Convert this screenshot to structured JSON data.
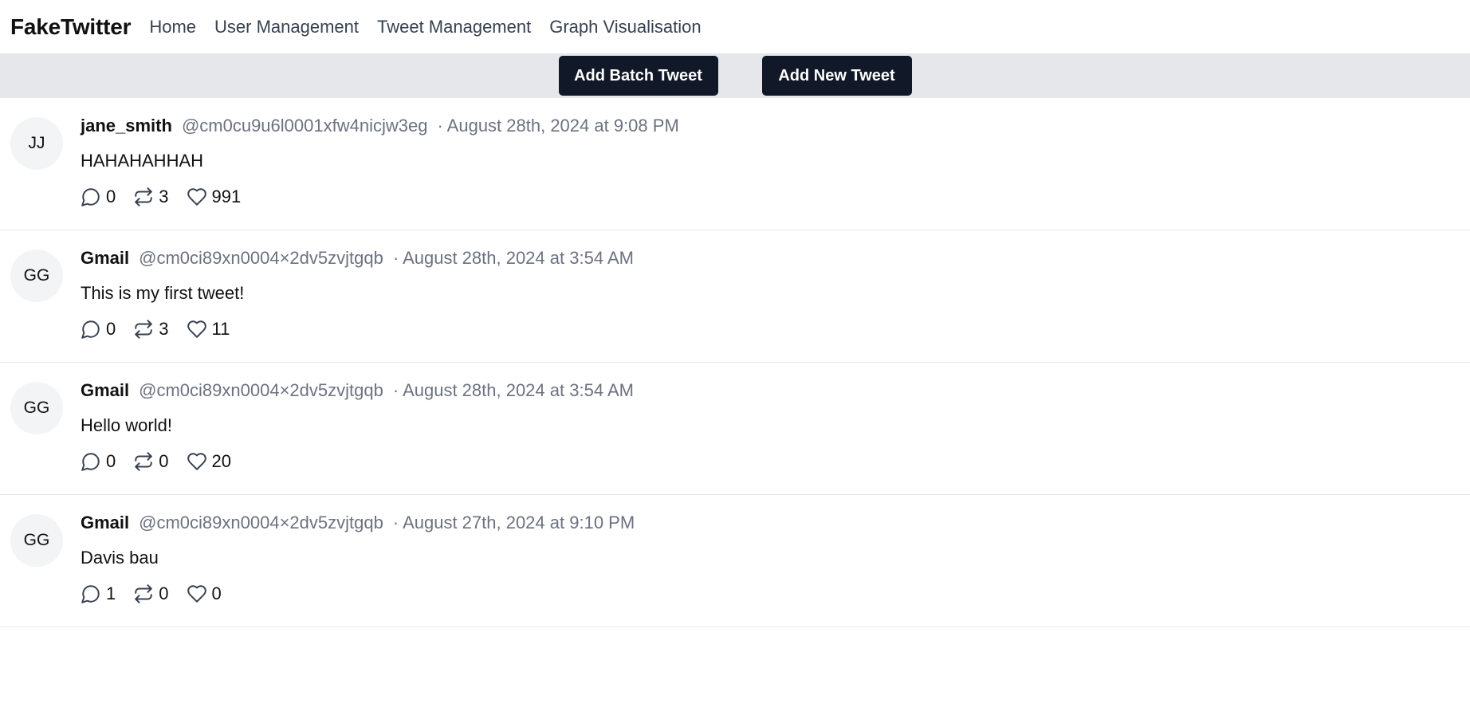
{
  "nav": {
    "brand": "FakeTwitter",
    "links": [
      "Home",
      "User Management",
      "Tweet Management",
      "Graph Visualisation"
    ]
  },
  "actions": {
    "add_batch": "Add Batch Tweet",
    "add_new": "Add New Tweet"
  },
  "colors": {
    "button_bg": "#111827",
    "action_bar_bg": "#e5e7eb",
    "muted_text": "#6b7280",
    "avatar_bg": "#f3f4f6"
  },
  "icons": {
    "reply": "speech-bubble-icon",
    "retweet": "retweet-arrows-icon",
    "like": "heart-icon"
  },
  "tweets": [
    {
      "initials": "JJ",
      "username": "jane_smith",
      "handle": "@cm0cu9u6l0001xfw4nicjw3eg",
      "timestamp": "· August 28th, 2024 at 9:08 PM",
      "content": "HAHAHAHHAH",
      "replies": "0",
      "retweets": "3",
      "likes": "991"
    },
    {
      "initials": "GG",
      "username": "Gmail",
      "handle": "@cm0ci89xn0004×2dv5zvjtgqb",
      "timestamp": "· August 28th, 2024 at 3:54 AM",
      "content": "This is my first tweet!",
      "replies": "0",
      "retweets": "3",
      "likes": "11"
    },
    {
      "initials": "GG",
      "username": "Gmail",
      "handle": "@cm0ci89xn0004×2dv5zvjtgqb",
      "timestamp": "· August 28th, 2024 at 3:54 AM",
      "content": "Hello world!",
      "replies": "0",
      "retweets": "0",
      "likes": "20"
    },
    {
      "initials": "GG",
      "username": "Gmail",
      "handle": "@cm0ci89xn0004×2dv5zvjtgqb",
      "timestamp": "· August 27th, 2024 at 9:10 PM",
      "content": "Davis bau",
      "replies": "1",
      "retweets": "0",
      "likes": "0"
    }
  ]
}
